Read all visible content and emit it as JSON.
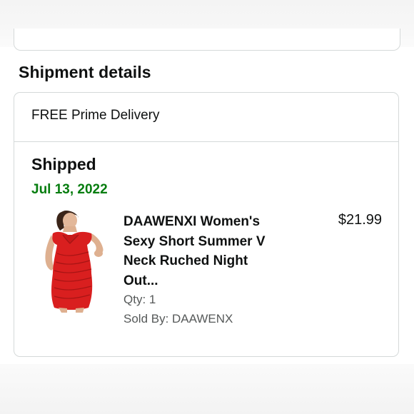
{
  "shipment": {
    "section_title": "Shipment details",
    "delivery_type": "FREE Prime Delivery",
    "status": "Shipped",
    "status_date": "Jul 13, 2022",
    "status_date_color": "#067d0f",
    "item": {
      "title": "DAAWENXI Women's Sexy Short Summer V Neck Ruched Night Out...",
      "price": "$21.99",
      "quantity": "Qty: 1",
      "seller": "Sold By: DAAWENX",
      "image_icon": "red-dress-product-image",
      "dress_color": "#d91f1f"
    }
  }
}
